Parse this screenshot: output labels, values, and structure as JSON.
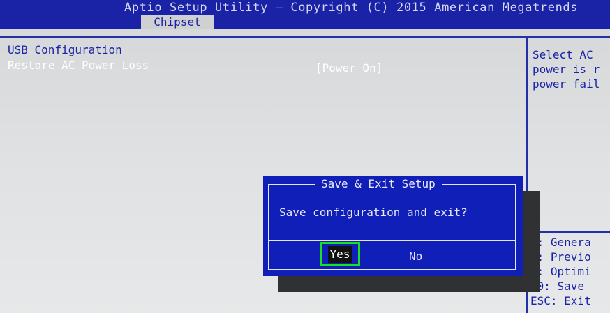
{
  "header": {
    "title": "Aptio Setup Utility – Copyright (C) 2015 American Megatrends",
    "active_tab": "Chipset"
  },
  "main": {
    "items": [
      {
        "label": "USB Configuration"
      },
      {
        "label": "Restore AC Power Loss",
        "value": "[Power On]"
      }
    ]
  },
  "help": {
    "lines": [
      "Select AC",
      "power is r",
      "power fail"
    ]
  },
  "keys": [
    "1: Genera",
    "2: Previo",
    "9: Optimi",
    "10: Save",
    "ESC: Exit"
  ],
  "dialog": {
    "title": "Save & Exit Setup",
    "message": "Save configuration and exit?",
    "yes_label": "Yes",
    "no_label": "No"
  },
  "colors": {
    "header_bg": "#1a23a6",
    "dialog_bg": "#0f1fb8",
    "highlight": "#19e11f"
  }
}
